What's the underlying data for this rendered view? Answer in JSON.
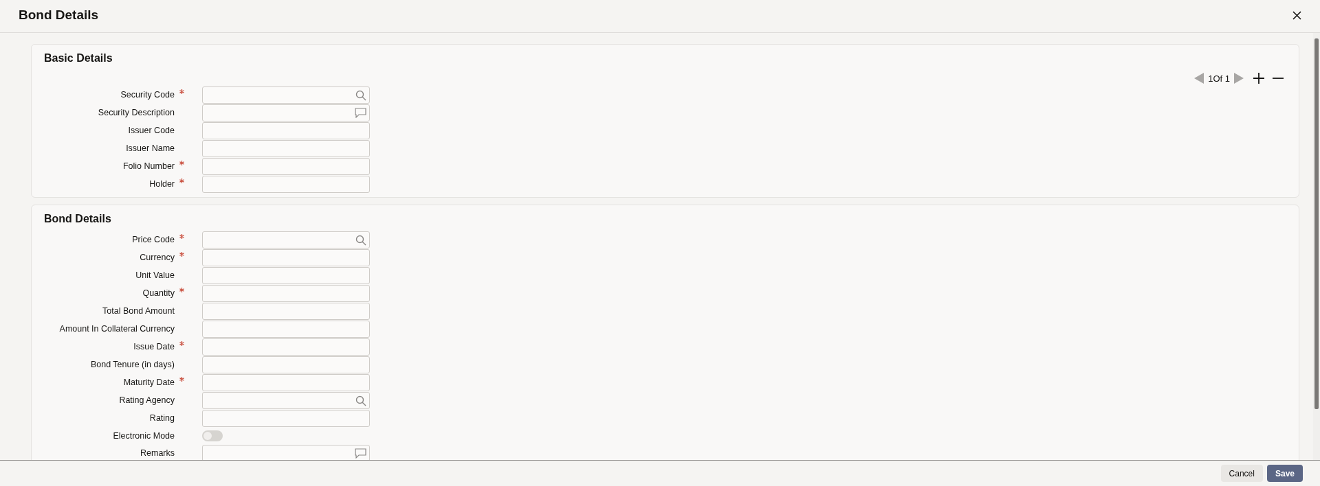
{
  "window": {
    "title": "Bond Details"
  },
  "sections": [
    {
      "title": "Basic Details",
      "pager": {
        "text": "1Of 1"
      },
      "fields": [
        {
          "label": "Security Code",
          "required": true,
          "kind": "search"
        },
        {
          "label": "Security Description",
          "required": false,
          "kind": "comment"
        },
        {
          "label": "Issuer Code",
          "required": false,
          "kind": "text"
        },
        {
          "label": "Issuer Name",
          "required": false,
          "kind": "text"
        },
        {
          "label": "Folio Number",
          "required": true,
          "kind": "text"
        },
        {
          "label": "Holder",
          "required": true,
          "kind": "text"
        }
      ]
    },
    {
      "title": "Bond Details",
      "fields": [
        {
          "label": "Price Code",
          "required": true,
          "kind": "search"
        },
        {
          "label": "Currency",
          "required": true,
          "kind": "text"
        },
        {
          "label": "Unit Value",
          "required": false,
          "kind": "text"
        },
        {
          "label": "Quantity",
          "required": true,
          "kind": "text"
        },
        {
          "label": "Total Bond Amount",
          "required": false,
          "kind": "text"
        },
        {
          "label": "Amount In Collateral Currency",
          "required": false,
          "kind": "text"
        },
        {
          "label": "Issue Date",
          "required": true,
          "kind": "text"
        },
        {
          "label": "Bond Tenure (in days)",
          "required": false,
          "kind": "text"
        },
        {
          "label": "Maturity Date",
          "required": true,
          "kind": "text"
        },
        {
          "label": "Rating Agency",
          "required": false,
          "kind": "search"
        },
        {
          "label": "Rating",
          "required": false,
          "kind": "text"
        },
        {
          "label": "Electronic Mode",
          "required": false,
          "kind": "toggle",
          "on": false
        },
        {
          "label": "Remarks",
          "required": false,
          "kind": "comment"
        }
      ]
    }
  ],
  "buttons": [
    {
      "label": "Cancel",
      "kind": "secondary"
    },
    {
      "label": "Save",
      "kind": "primary"
    }
  ]
}
